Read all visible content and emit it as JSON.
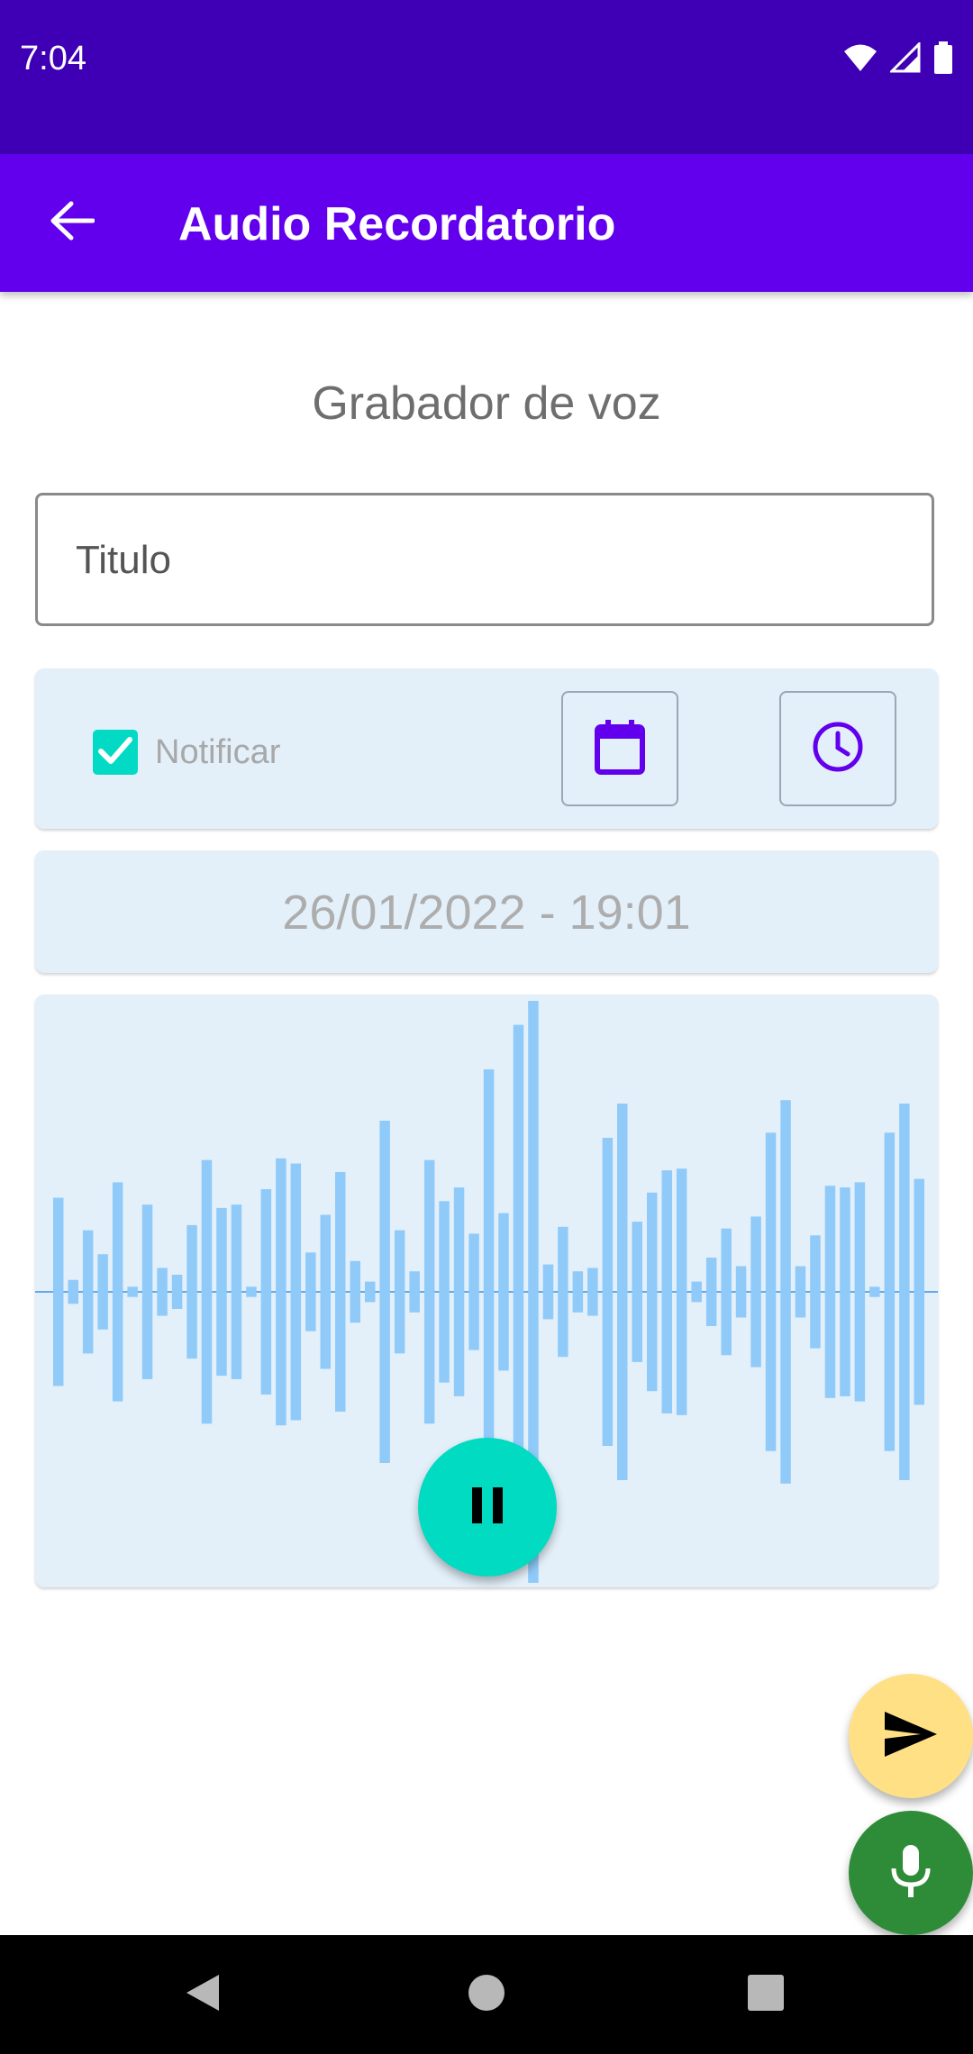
{
  "status_bar": {
    "time": "7:04",
    "icons": [
      "wifi-icon",
      "signal-icon",
      "battery-icon"
    ]
  },
  "app_bar": {
    "title": "Audio Recordatorio",
    "back_icon": "arrow-back-icon"
  },
  "main": {
    "section_title": "Grabador de voz",
    "title_field": {
      "placeholder": "Titulo",
      "value": ""
    },
    "notify": {
      "label": "Notificar",
      "checked": true
    },
    "date_button_icon": "calendar-icon",
    "time_button_icon": "clock-icon",
    "datetime_text": "26/01/2022 - 19:01",
    "waveform": {
      "levels": [
        0.55,
        0.07,
        0.36,
        0.22,
        0.64,
        0.03,
        0.51,
        0.14,
        0.1,
        0.39,
        0.77,
        0.49,
        0.51,
        0.03,
        0.6,
        0.78,
        0.75,
        0.23,
        0.45,
        0.7,
        0.18,
        0.06,
        1.0,
        0.36,
        0.12,
        0.77,
        0.53,
        0.61,
        0.34,
        1.3,
        0.46,
        1.56,
        1.7,
        0.16,
        0.38,
        0.12,
        0.14,
        0.9,
        1.1,
        0.41,
        0.58,
        0.71,
        0.72,
        0.06,
        0.2,
        0.37,
        0.15,
        0.44,
        0.93,
        1.12,
        0.15,
        0.33,
        0.62,
        0.61,
        0.64,
        0.03,
        0.93,
        1.1,
        0.66
      ],
      "color": "#90caf9"
    }
  },
  "controls": {
    "pause_icon": "pause-icon",
    "send_icon": "send-icon",
    "mic_icon": "mic-icon"
  },
  "nav_bar": {
    "icons": [
      "nav-back-icon",
      "nav-home-icon",
      "nav-recents-icon"
    ]
  },
  "colors": {
    "status_bar": "#3f00b5",
    "app_bar": "#6200ee",
    "card_bg": "#e3f0fa",
    "accent_teal": "#03dac5",
    "send_fab": "#ffe085",
    "mic_fab": "#2e8c38"
  }
}
